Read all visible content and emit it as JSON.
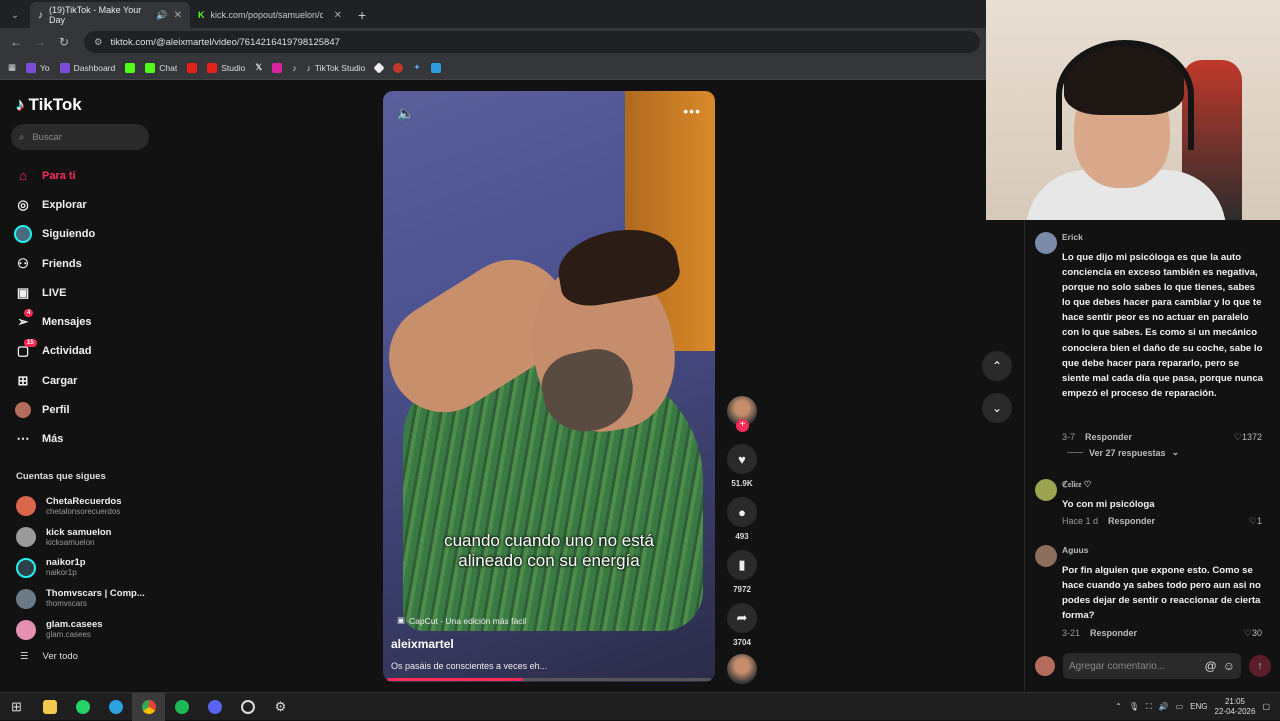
{
  "browser": {
    "tabs": [
      {
        "title": "(19)TikTok - Make Your Day",
        "active": true
      },
      {
        "title": "kick.com/popout/samuelon/ch",
        "active": false
      }
    ],
    "url": "tiktok.com/@aleixmartel/video/7614216419798125847",
    "bookmarks": [
      "Yo",
      "Dashboard",
      "Chat",
      "Studio",
      "TikTok Studio"
    ]
  },
  "sidebar": {
    "logo": "TikTok",
    "search_placeholder": "Buscar",
    "nav": [
      {
        "label": "Para ti",
        "icon": "home-icon",
        "active": true
      },
      {
        "label": "Explorar",
        "icon": "compass-icon"
      },
      {
        "label": "Siguiendo",
        "icon": "following-icon"
      },
      {
        "label": "Friends",
        "icon": "friends-icon"
      },
      {
        "label": "LIVE",
        "icon": "live-icon"
      },
      {
        "label": "Mensajes",
        "icon": "messages-icon",
        "badge": "4"
      },
      {
        "label": "Actividad",
        "icon": "activity-icon",
        "badge": "15"
      },
      {
        "label": "Cargar",
        "icon": "upload-icon"
      },
      {
        "label": "Perfil",
        "icon": "profile-icon"
      },
      {
        "label": "Más",
        "icon": "more-icon"
      }
    ],
    "following_title": "Cuentas que sigues",
    "following": [
      {
        "name": "ChetaRecuerdos",
        "handle": "chetalonsorecuerdos",
        "color": "#d9664a"
      },
      {
        "name": "kick samuelon",
        "handle": "kicksamuelon",
        "color": "#9a9a9a"
      },
      {
        "name": "naikor1p",
        "handle": "naikor1p",
        "color": "#2f8f87"
      },
      {
        "name": "Thomvscars | Comp...",
        "handle": "thomvscars",
        "color": "#6c7a86"
      },
      {
        "name": "glam.casees",
        "handle": "glam.casees",
        "color": "#e58fb1"
      }
    ],
    "see_all": "Ver todo"
  },
  "video": {
    "subtitle_line1": "cuando cuando uno no está",
    "subtitle_line2": "alineado con su energía",
    "capcut": "CapCut - Una edición más fácil",
    "author": "aleixmartel",
    "description": "Os pasáis de conscientes a veces eh...",
    "progress": 0.42
  },
  "actions": {
    "likes": "51.9K",
    "comments": "493",
    "saves": "7972",
    "shares": "3704"
  },
  "comments": [
    {
      "user": "Erick",
      "text": "Lo que dijo mi psicóloga es que la auto conciencia en exceso también es negativa, porque no solo sabes lo que tienes, sabes lo que debes hacer para cambiar y lo que te hace sentir peor es no actuar en paralelo con lo que sabes. Es como si un mecánico conociera bien el daño de su coche, sabe lo que debe hacer para repararlo, pero se siente mal cada día que pasa, porque nunca empezó el proceso de reparación.",
      "date": "3-7",
      "reply": "Responder",
      "likes": "1372",
      "color": "#7a8aa8"
    },
    {
      "user": "ℭ𝔢𝔩𝔦𝔠𝔢 ♡",
      "text": "Yo con mi psicóloga",
      "date": "Hace 1 d",
      "reply": "Responder",
      "likes": "1",
      "color": "#9ba34f"
    },
    {
      "user": "Aguus",
      "text": "Por fin alguien que expone esto. Como se hace cuando ya sabes todo pero aun asi no podes dejar de sentir o reaccionar de cierta forma?",
      "date": "3-21",
      "reply": "Responder",
      "likes": "30",
      "color": "#8a6d5a"
    }
  ],
  "more_replies": "Ver 27 respuestas",
  "composer_placeholder": "Agregar comentario...",
  "taskbar": {
    "lang": "ENG",
    "time": "21:05",
    "date": "22-04-2026"
  }
}
